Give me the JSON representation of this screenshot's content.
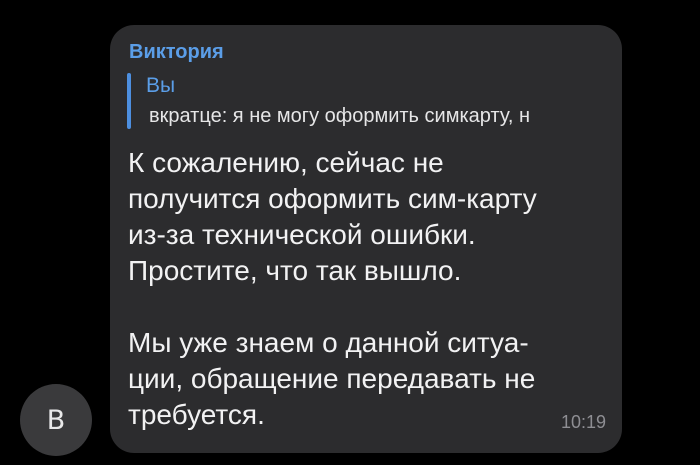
{
  "chat": {
    "avatar_letter": "В",
    "sender_name": "Виктория",
    "reply": {
      "author": "Вы",
      "text": "вкратце: я не могу оформить симкарту, н"
    },
    "message": {
      "lines": [
        "К сожалению, сейчас не",
        "получится оформить сим-карту",
        "из-за технической ошибки.",
        "Простите, что так вышло.",
        "",
        "Мы уже знаем о данной ситуа-",
        "ции, обращение передавать не",
        "требуется."
      ],
      "time": "10:19"
    }
  },
  "colors": {
    "background": "#000000",
    "bubble": "#2c2c2e",
    "accent": "#5b9ee8",
    "text": "#f2f2f3",
    "meta": "#8e8e93"
  }
}
